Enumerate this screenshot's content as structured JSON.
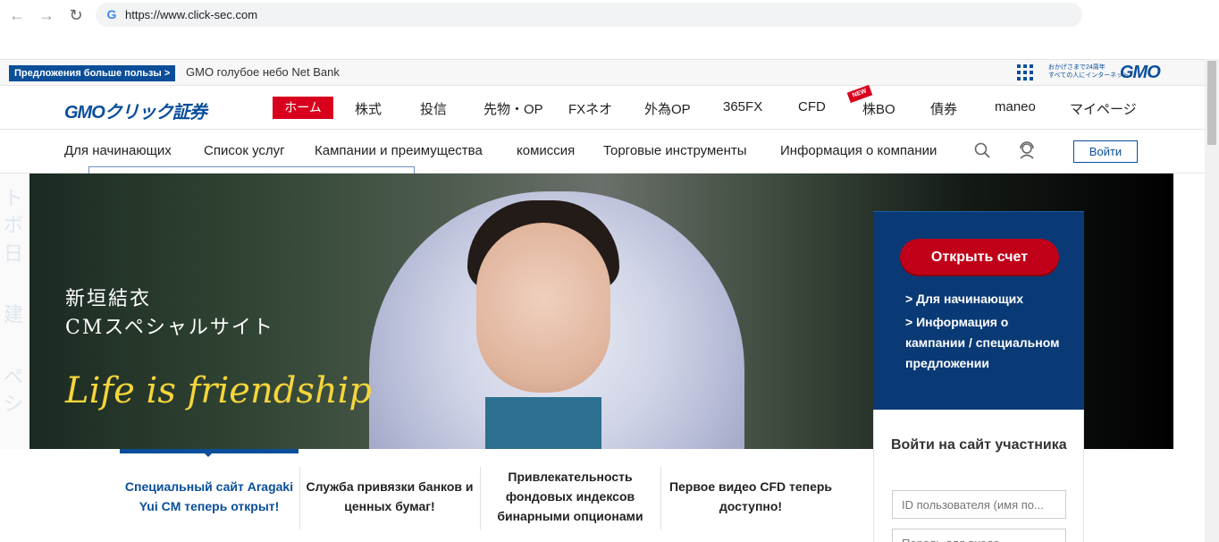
{
  "browser": {
    "url": "https://www.click-sec.com"
  },
  "topstrip": {
    "promo_badge": "Предложения больше пользы >",
    "promo_text": "GMO голубое небо Net Bank",
    "gmo_tag_line1": "おかげさまで24周年",
    "gmo_tag_line2": "すべての人にインターネット",
    "gmo_logo": "GMO"
  },
  "mainnav": {
    "logo": "GMOクリック証券",
    "items": [
      "ホーム",
      "株式",
      "投信",
      "先物・OP",
      "FXネオ",
      "外為OP",
      "365FX",
      "CFD",
      "株BO",
      "債券",
      "maneo",
      "マイページ"
    ],
    "new_badge": "NEW"
  },
  "subnav": {
    "items": [
      "Для начинающих",
      "Список услуг",
      "Кампании и преимущества",
      "комиссия",
      "Торговые инструменты",
      "Информация о компании"
    ],
    "login": "Войти"
  },
  "hero": {
    "jp_line1": "新垣結衣",
    "jp_line2": "CMスペシャルサイト",
    "script": "Life is friendship"
  },
  "account": {
    "open_button": "Открыть счет",
    "link1": "> Для начинающих",
    "link2": "> Информация о кампании / специальном предложении"
  },
  "member": {
    "title": "Войти на сайт участника",
    "id_placeholder": "ID пользователя (имя по...",
    "pw_placeholder": "Пароль для входа"
  },
  "features": [
    "Специальный сайт Aragaki Yui CM теперь открыт!",
    "Служба привязки банков и ценных бумаг!",
    "Привлекательность фондовых индексов бинарными опционами",
    "Первое видео CFD теперь доступно!"
  ]
}
